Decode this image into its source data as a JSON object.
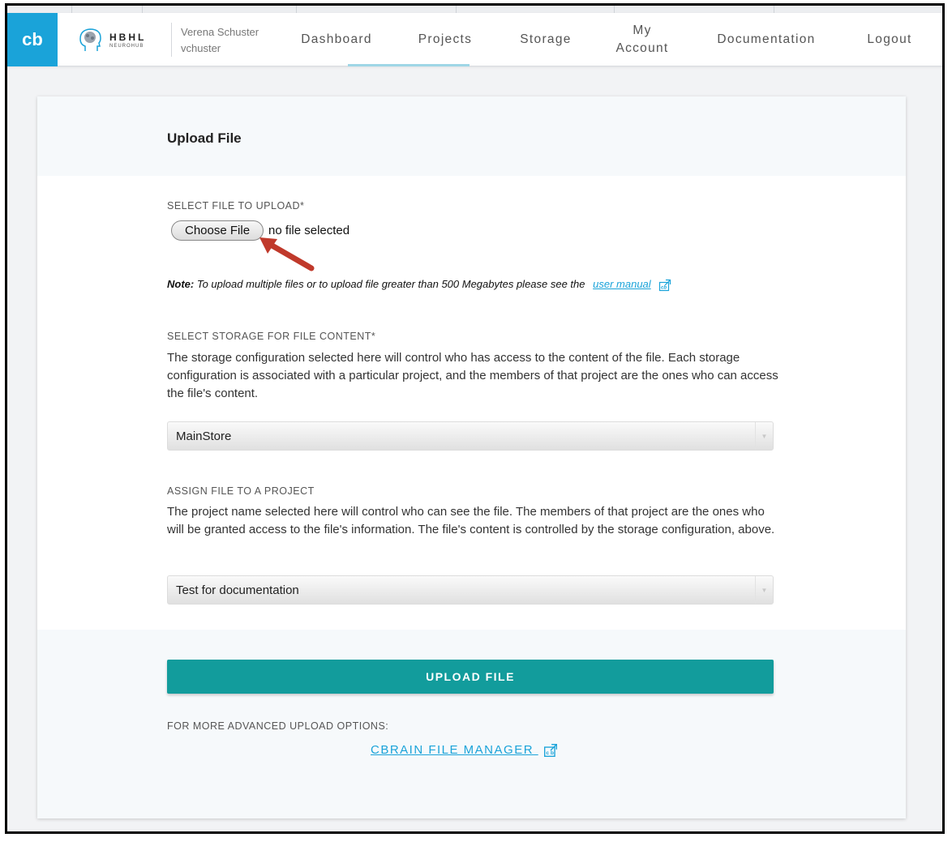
{
  "brand": {
    "logo_text": "cb",
    "partner_title": "HBHL",
    "partner_subtitle": "NEUROHUB"
  },
  "user": {
    "name": "Verena Schuster",
    "username": "vchuster"
  },
  "nav": {
    "items": [
      {
        "label": "Dashboard"
      },
      {
        "label": "Projects"
      },
      {
        "label": "Storage"
      },
      {
        "label_line1": "My",
        "label_line2": "Account"
      },
      {
        "label": "Documentation"
      },
      {
        "label": "Logout"
      }
    ]
  },
  "form": {
    "title": "Upload File",
    "file": {
      "label": "SELECT FILE TO UPLOAD*",
      "button_label": "Choose File",
      "status": "no file selected"
    },
    "note": {
      "prefix": "Note:",
      "text": "To upload multiple files or to upload file greater than 500 Megabytes please see the",
      "link": "user manual"
    },
    "storage": {
      "label": "SELECT STORAGE FOR FILE CONTENT*",
      "description": "The storage configuration selected here will control who has access to the content of the file. Each storage configuration is associated with a particular project, and the members of that project are the ones who can access the file's content.",
      "selected": "MainStore"
    },
    "project": {
      "label": "ASSIGN FILE TO A PROJECT",
      "description": "The project name selected here will control who can see the file. The members of that project are the ones who will be granted access to the file's information. The file's content is controlled by the storage configuration, above.",
      "selected": "Test for documentation"
    },
    "submit_label": "UPLOAD FILE",
    "advanced": {
      "label": "FOR MORE ADVANCED UPLOAD OPTIONS:",
      "link": "CBRAIN FILE MANAGER"
    }
  },
  "colors": {
    "brand_blue": "#1aa3d9",
    "primary_teal": "#129c9c",
    "annotation_arrow": "#c0392b"
  },
  "icons": [
    "external-link-icon",
    "caret-down-icon",
    "brain-head-icon",
    "annotation-arrow"
  ]
}
